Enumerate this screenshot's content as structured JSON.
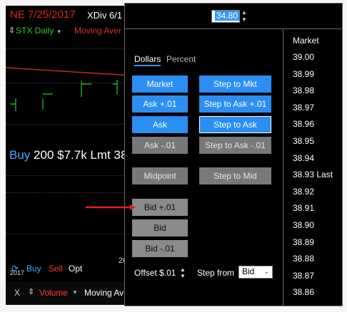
{
  "chart": {
    "title": "NE 7/25/2017",
    "subtitle": "XDiv 6/1",
    "series_label": "STX Daily",
    "ma_label": "Moving Aver",
    "order_line": {
      "side": "Buy",
      "rest": "200 $7.7k Lmt 38"
    },
    "bottom": {
      "buy": "Buy",
      "sell": "Sell",
      "opt": "Opt",
      "date_fragment": "26",
      "year_fragment": "2017"
    },
    "status": {
      "close": "X",
      "move": "⇕",
      "volume": "Volume",
      "moving_avg": "Moving Av"
    }
  },
  "price_input": {
    "value": "34.80"
  },
  "tabs": [
    {
      "label": "Dollars",
      "active": true
    },
    {
      "label": "Percent",
      "active": false
    }
  ],
  "buttons": {
    "market": "Market",
    "step_to_mkt": "Step to Mkt",
    "ask_plus": "Ask +.01",
    "step_to_ask_plus": "Step to Ask +.01",
    "ask": "Ask",
    "step_to_ask": "Step to Ask",
    "ask_minus": "Ask -.01",
    "step_to_ask_minus": "Step to Ask -.01",
    "midpoint": "Midpoint",
    "step_to_mid": "Step to Mid",
    "bid_plus": "Bid +.01",
    "bid": "Bid",
    "bid_minus": "Bid -.01"
  },
  "footer": {
    "offset_label": "Offset $.01",
    "step_from_label": "Step from",
    "step_from_value": "Bid"
  },
  "market_list": {
    "header": "Market",
    "items": [
      "39.00",
      "38.99",
      "38.98",
      "38.97",
      "38.96",
      "38.95",
      "38.94",
      "38.93 Last",
      "38.92",
      "38.91",
      "38.90",
      "38.89",
      "38.88",
      "38.87",
      "38.86"
    ]
  },
  "colors": {
    "accent_blue": "#2b8ef2",
    "bar_green": "#2fc62f",
    "ma_red": "#d8312c",
    "annotation_red": "#e0201c"
  }
}
